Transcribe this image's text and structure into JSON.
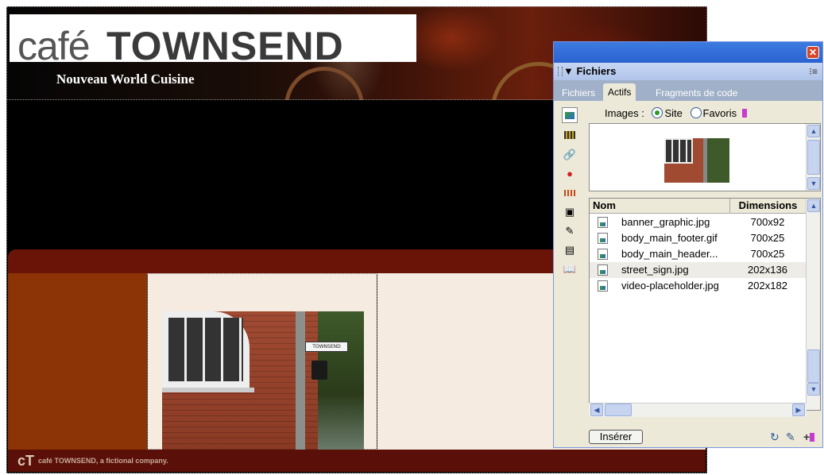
{
  "site": {
    "logo_cafe": "café",
    "logo_townsend": "TOWNSEND",
    "tagline": "Nouveau World Cuisine",
    "street_sign": "TOWNSEND",
    "footer_logo": "cT",
    "footer_text": "café TOWNSEND, a fictional company."
  },
  "panel": {
    "title": "Fichiers",
    "close": "✕",
    "options_icon": "panel-options-icon",
    "tabs": [
      {
        "label": "Fichiers",
        "active": false
      },
      {
        "label": "Actifs",
        "active": true
      },
      {
        "label": "Fragments de code",
        "active": false
      }
    ],
    "images_label": "Images :",
    "radio_site": "Site",
    "radio_favoris": "Favoris",
    "radio_selected": "Site",
    "tools": [
      "images-icon",
      "colors-icon",
      "urls-icon",
      "flash-icon",
      "shockwave-icon",
      "movies-icon",
      "scripts-icon",
      "templates-icon",
      "library-icon"
    ],
    "columns": {
      "name": "Nom",
      "dimensions": "Dimensions"
    },
    "files": [
      {
        "name": "banner_graphic.jpg",
        "dimensions": "700x92",
        "selected": false
      },
      {
        "name": "body_main_footer.gif",
        "dimensions": "700x25",
        "selected": false
      },
      {
        "name": "body_main_header...",
        "dimensions": "700x25",
        "selected": false
      },
      {
        "name": "street_sign.jpg",
        "dimensions": "202x136",
        "selected": true
      },
      {
        "name": "video-placeholder.jpg",
        "dimensions": "202x182",
        "selected": false
      }
    ],
    "insert_button": "Insérer",
    "footer_icons": [
      "refresh-icon",
      "edit-icon",
      "add-to-favorites-icon"
    ]
  },
  "colors": {
    "banner_bg": "#000000",
    "red_bar": "#6a1408",
    "sidebar": "#8c3406",
    "content_bg": "#f6ebe0",
    "panel_header": "#2a63d0"
  }
}
